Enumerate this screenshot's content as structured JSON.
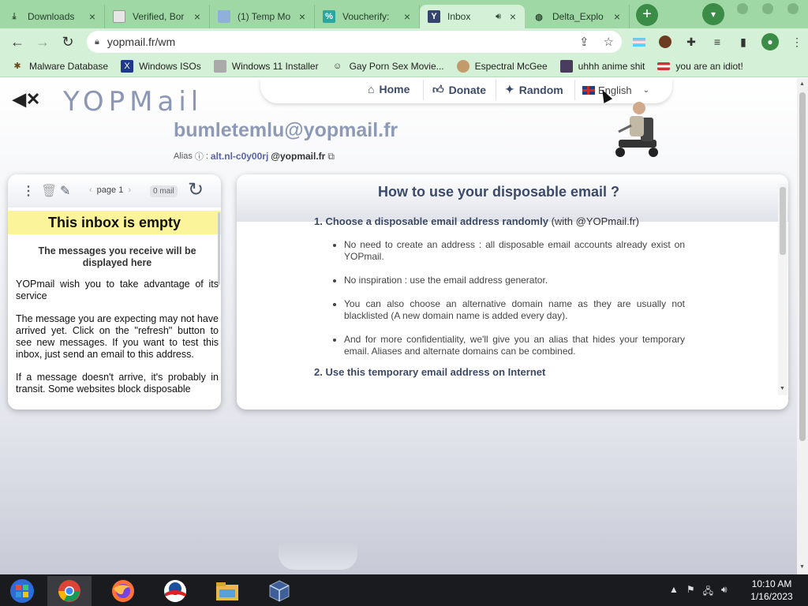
{
  "browser": {
    "tabs": [
      {
        "title": "Downloads",
        "icon": "download-icon"
      },
      {
        "title": "Verified, Bor",
        "icon": "page-icon"
      },
      {
        "title": "(1) Temp Mo",
        "icon": "photo-icon"
      },
      {
        "title": "Voucherify: ",
        "icon": "percent-icon"
      },
      {
        "title": "Inbox",
        "icon": "yopmail-icon",
        "active": true,
        "audio": true
      },
      {
        "title": "Delta_Explo",
        "icon": "globe-icon"
      }
    ],
    "url": "yopmail.fr/wm",
    "bookmarks": [
      {
        "label": "Malware Database",
        "icon": "bug-icon"
      },
      {
        "label": "Windows ISOs",
        "icon": "x-logo-icon"
      },
      {
        "label": "Windows 11 Installer",
        "icon": "floppy-icon"
      },
      {
        "label": "Gay Porn Sex Movie...",
        "icon": "smiley-icon"
      },
      {
        "label": "Espectral McGee",
        "icon": "avatar-icon"
      },
      {
        "label": "uhhh anime shit",
        "icon": "anime-icon"
      },
      {
        "label": "you are an idiot!",
        "icon": "flag-icon"
      }
    ],
    "colors": {
      "frame": "#9fd8a4",
      "toolbar": "#d4f0d6",
      "accent": "#3b8c47"
    }
  },
  "site": {
    "logo": "YOPMail",
    "nav": {
      "home": "Home",
      "donate": "Donate",
      "random": "Random",
      "language": "English"
    },
    "email": "bumletemlu@yopmail.fr",
    "alias_label": "Alias",
    "alias_name": "alt.nl-c0y00rj",
    "alias_domain": "@yopmail.fr",
    "inbox": {
      "page": "page 1",
      "count": "0 mail",
      "empty_title": "This inbox is empty",
      "subtitle": "The messages you receive will be displayed here",
      "para1": "YOPmail wish you to take advantage of its service",
      "para2": "The message you are expecting may not have arrived yet. Click on the \"refresh\" button to see new messages. If you want to test this inbox, just send an email to this address.",
      "para3": "If a message doesn't arrive, it's probably in transit. Some websites block disposable"
    },
    "help": {
      "title": "How to use your disposable email ?",
      "step1": "1. Choose a disposable email address randomly",
      "step1_suffix": "(with @YOPmail.fr)",
      "bullets": [
        "No need to create an address : all disposable email accounts already exist on YOPmail.",
        "No inspiration : use the email address generator.",
        "You can also choose an alternative domain name as they are usually not blacklisted (A new domain name is added every day).",
        "And for more confidentiality, we'll give you an alias that hides your temporary email. Aliases and alternate domains can be combined."
      ],
      "step2": "2. Use this temporary email address on Internet"
    },
    "colors": {
      "heading": "#3c4a68",
      "email": "#8e9ab5",
      "banner": "#fcf49a"
    }
  },
  "taskbar": {
    "time": "10:10 AM",
    "date": "1/16/2023",
    "apps": [
      "windows-start-icon",
      "chrome-icon",
      "firefox-icon",
      "obama-logo-icon",
      "file-explorer-icon",
      "virtualbox-icon"
    ]
  }
}
